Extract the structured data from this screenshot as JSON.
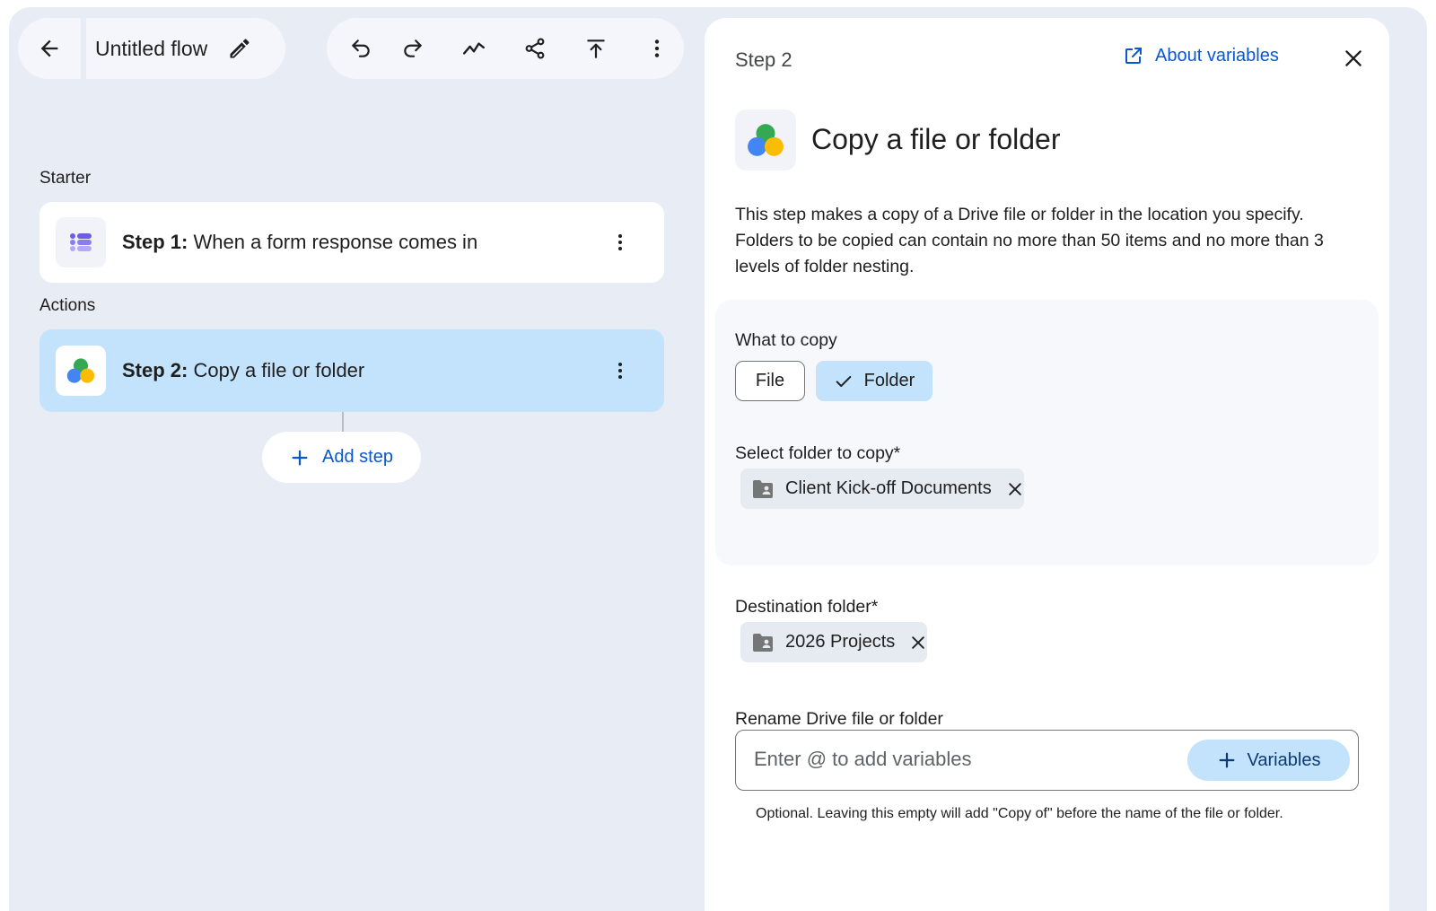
{
  "toolbar": {
    "flow_title": "Untitled flow",
    "tools": [
      "undo-icon",
      "redo-icon",
      "activity-icon",
      "share-icon",
      "publish-icon",
      "more-vert-icon"
    ]
  },
  "canvas": {
    "starter_label": "Starter",
    "actions_label": "Actions",
    "step1": {
      "prefix": "Step 1:",
      "text": "When a form response comes in"
    },
    "step2": {
      "prefix": "Step 2:",
      "text": "Copy a file or folder"
    },
    "add_step_label": "Add step"
  },
  "panel": {
    "step_label": "Step 2",
    "about_link": "About variables",
    "title": "Copy a file or folder",
    "description": "This step makes a copy of a Drive file or folder in the location you specify. Folders to be copied can contain no more than 50 items and no more than 3 levels of folder nesting.",
    "what_to_copy": {
      "label": "What to copy",
      "options": [
        "File",
        "Folder"
      ],
      "selected": "Folder"
    },
    "select_folder": {
      "label": "Select folder to copy*",
      "chip": "Client Kick-off Documents"
    },
    "destination": {
      "label": "Destination folder*",
      "chip": "2026 Projects"
    },
    "rename": {
      "label": "Rename Drive file or folder",
      "value": "",
      "placeholder": "Enter @ to add variables",
      "variables_button": "Variables",
      "helper": "Optional. Leaving this empty will add \"Copy of\" before the name of the file or folder."
    }
  },
  "colors": {
    "accent": "#0b57d0",
    "selected_bg": "#c2e3fb",
    "canvas_bg": "#e8ecf5",
    "drive_green": "#34a853",
    "drive_blue": "#4285f4",
    "drive_yellow": "#fbbc04"
  }
}
